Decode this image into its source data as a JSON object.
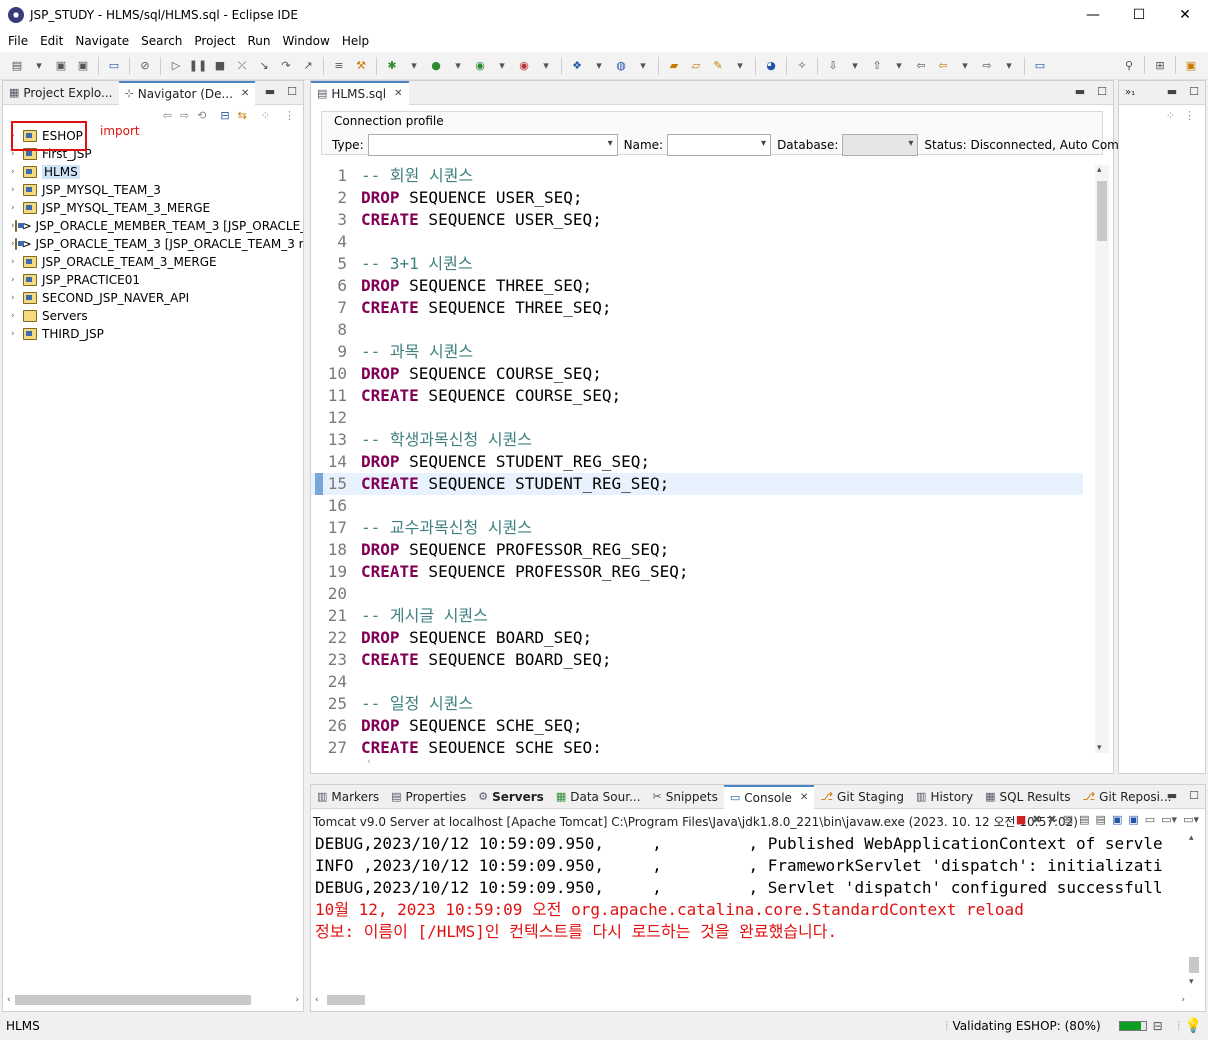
{
  "window": {
    "title": "JSP_STUDY - HLMS/sql/HLMS.sql - Eclipse IDE"
  },
  "menu": [
    "File",
    "Edit",
    "Navigate",
    "Search",
    "Project",
    "Run",
    "Window",
    "Help"
  ],
  "left_pane": {
    "tabs": [
      {
        "label": "Project Explo...",
        "active": false
      },
      {
        "label": "Navigator (De...",
        "active": true
      }
    ],
    "tree": [
      "ESHOP",
      "First_JSP",
      "HLMS",
      "JSP_MYSQL_TEAM_3",
      "JSP_MYSQL_TEAM_3_MERGE",
      "> JSP_ORACLE_MEMBER_TEAM_3 [JSP_ORACLE_",
      "> JSP_ORACLE_TEAM_3 [JSP_ORACLE_TEAM_3 r",
      "JSP_ORACLE_TEAM_3_MERGE",
      "JSP_PRACTICE01",
      "SECOND_JSP_NAVER_API",
      "Servers",
      "THIRD_JSP"
    ],
    "selected": "HLMS",
    "annotation": "import"
  },
  "editor": {
    "tab": "HLMS.sql",
    "connection_profile": {
      "header": "Connection profile",
      "type_label": "Type:",
      "name_label": "Name:",
      "database_label": "Database:",
      "status": "Status: Disconnected, Auto Comr"
    },
    "lines": [
      {
        "n": "1",
        "t": "-- 회원 시퀀스",
        "k": "c"
      },
      {
        "n": "2",
        "kw": "DROP",
        "t": " SEQUENCE USER_SEQ;"
      },
      {
        "n": "3",
        "kw": "CREATE",
        "t": " SEQUENCE USER_SEQ;"
      },
      {
        "n": "4",
        "t": ""
      },
      {
        "n": "5",
        "t": "-- 3+1 시퀀스",
        "k": "c"
      },
      {
        "n": "6",
        "kw": "DROP",
        "t": " SEQUENCE THREE_SEQ;"
      },
      {
        "n": "7",
        "kw": "CREATE",
        "t": " SEQUENCE THREE_SEQ;"
      },
      {
        "n": "8",
        "t": ""
      },
      {
        "n": "9",
        "t": "-- 과목 시퀀스",
        "k": "c"
      },
      {
        "n": "10",
        "kw": "DROP",
        "t": " SEQUENCE COURSE_SEQ;"
      },
      {
        "n": "11",
        "kw": "CREATE",
        "t": " SEQUENCE COURSE_SEQ;"
      },
      {
        "n": "12",
        "t": ""
      },
      {
        "n": "13",
        "t": "-- 학생과목신청 시퀀스",
        "k": "c"
      },
      {
        "n": "14",
        "kw": "DROP",
        "t": " SEQUENCE STUDENT_REG_SEQ;"
      },
      {
        "n": "15",
        "kw": "CREATE",
        "t": " SEQUENCE STUDENT_REG_SEQ;",
        "cur": true
      },
      {
        "n": "16",
        "t": ""
      },
      {
        "n": "17",
        "t": "-- 교수과목신청 시퀀스",
        "k": "c"
      },
      {
        "n": "18",
        "kw": "DROP",
        "t": " SEQUENCE PROFESSOR_REG_SEQ;"
      },
      {
        "n": "19",
        "kw": "CREATE",
        "t": " SEQUENCE PROFESSOR_REG_SEQ;"
      },
      {
        "n": "20",
        "t": ""
      },
      {
        "n": "21",
        "t": "-- 게시글 시퀀스",
        "k": "c"
      },
      {
        "n": "22",
        "kw": "DROP",
        "t": " SEQUENCE BOARD_SEQ;"
      },
      {
        "n": "23",
        "kw": "CREATE",
        "t": " SEQUENCE BOARD_SEQ;"
      },
      {
        "n": "24",
        "t": ""
      },
      {
        "n": "25",
        "t": "-- 일정 시퀀스",
        "k": "c"
      },
      {
        "n": "26",
        "kw": "DROP",
        "t": " SEQUENCE SCHE_SEQ;"
      },
      {
        "n": "27",
        "kw": "CREATE",
        "t": " SEQUENCE SCHE_SEQ;"
      }
    ]
  },
  "bottom_panel": {
    "tabs": [
      {
        "label": "Markers",
        "active": false
      },
      {
        "label": "Properties",
        "active": false
      },
      {
        "label": "Servers",
        "active": false,
        "bold": true
      },
      {
        "label": "Data Sour...",
        "active": false
      },
      {
        "label": "Snippets",
        "active": false
      },
      {
        "label": "Console",
        "active": true
      },
      {
        "label": "Git Staging",
        "active": false
      },
      {
        "label": "History",
        "active": false
      },
      {
        "label": "SQL Results",
        "active": false
      },
      {
        "label": "Git Reposi...",
        "active": false
      }
    ],
    "console_header": "Tomcat v9.0 Server at localhost [Apache Tomcat] C:\\Program Files\\Java\\jdk1.8.0_221\\bin\\javaw.exe  (2023. 10. 12 오전 10:57:02)",
    "lines": [
      {
        "t": "DEBUG,2023/10/12 10:59:09.950,     ,         , Published WebApplicationContext of servle",
        "err": false
      },
      {
        "t": "INFO ,2023/10/12 10:59:09.950,     ,         , FrameworkServlet 'dispatch': initializati",
        "err": false
      },
      {
        "t": "DEBUG,2023/10/12 10:59:09.950,     ,         , Servlet 'dispatch' configured successfull",
        "err": false
      },
      {
        "t": "10월 12, 2023 10:59:09 오전 org.apache.catalina.core.StandardContext reload",
        "err": true
      },
      {
        "t": "정보: 이름이 [/HLMS]인 컨텍스트를 다시 로드하는 것을 완료했습니다.",
        "err": true
      }
    ]
  },
  "status_bar": {
    "left": "HLMS",
    "right": "Validating ESHOP: (80%)",
    "progress_percent": 80
  }
}
